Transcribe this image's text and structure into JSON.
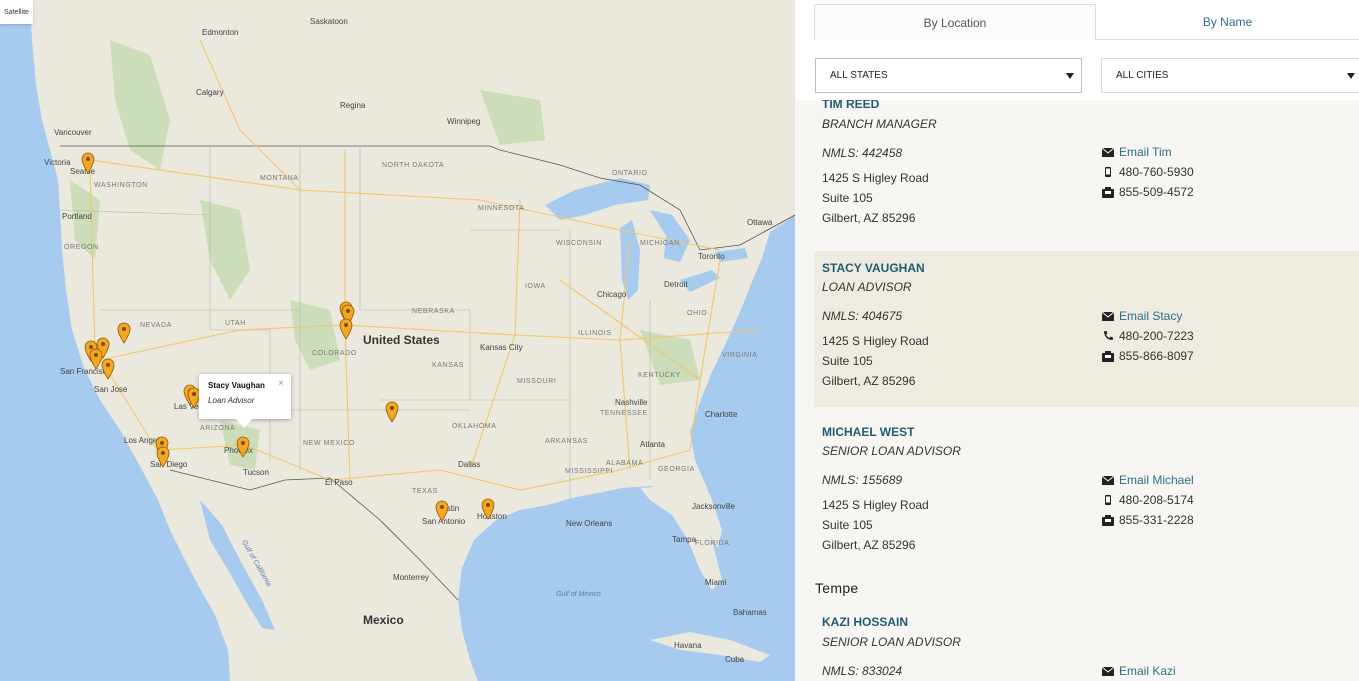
{
  "map": {
    "satellite_label": "Satellite",
    "info_window": {
      "name": "Stacy Vaughan",
      "title": "Loan Advisor",
      "close": "×"
    },
    "labels": {
      "edmonton": "Edmonton",
      "calgary": "Calgary",
      "saskatoon": "Saskatoon",
      "regina": "Regina",
      "winnipeg": "Winnipeg",
      "vancouver": "Vancouver",
      "victoria": "Victoria",
      "seattle": "Seattle",
      "portland": "Portland",
      "washington": "WASHINGTON",
      "oregon": "OREGON",
      "montana": "MONTANA",
      "north_dakota": "NORTH DAKOTA",
      "minnesota": "MINNESOTA",
      "wisconsin": "WISCONSIN",
      "michigan": "MICHIGAN",
      "ontario": "ONTARIO",
      "toronto": "Toronto",
      "ottawa": "Ottawa",
      "detroit": "Detroit",
      "chicago": "Chicago",
      "nebraska": "NEBRASKA",
      "iowa": "IOWA",
      "illinois": "ILLINOIS",
      "ohio": "OHIO",
      "united_states": "United States",
      "nevada": "NEVADA",
      "utah": "UTAH",
      "colorado": "COLORADO",
      "kansas": "KANSAS",
      "kansas_city": "Kansas City",
      "missouri": "MISSOURI",
      "kentucky": "KENTUCKY",
      "virginia": "VIRGINIA",
      "san_francisco": "San Francisco",
      "san_jose": "San Jose",
      "las_vegas": "Las Vegas",
      "los_angeles": "Los Angeles",
      "san_diego": "San Diego",
      "arizona": "ARIZONA",
      "phoenix": "Phoenix",
      "tucson": "Tucson",
      "new_mexico": "NEW MEXICO",
      "oklahoma": "OKLAHOMA",
      "arkansas": "ARKANSAS",
      "tennessee": "TENNESSEE",
      "nashville": "Nashville",
      "atlanta": "Atlanta",
      "charlotte": "Charlotte",
      "mississippi": "MISSISSIPPI",
      "alabama": "ALABAMA",
      "georgia": "GEORGIA",
      "el_paso": "El Paso",
      "dallas": "Dallas",
      "texas": "TEXAS",
      "austin": "Austin",
      "san_antonio": "San Antonio",
      "houston": "Houston",
      "new_orleans": "New Orleans",
      "jacksonville": "Jacksonville",
      "florida": "FLORIDA",
      "tampa": "Tampa",
      "miami": "Miami",
      "gulf_of_mexico": "Gulf of Mexico",
      "gulf_of_california": "Gulf of California",
      "mexico": "Mexico",
      "monterrey": "Monterrey",
      "bahamas": "Bahamas",
      "cuba": "Cuba",
      "havana": "Havana"
    }
  },
  "panel": {
    "tabs": {
      "by_location": "By Location",
      "by_name": "By Name"
    },
    "filters": {
      "states": "ALL STATES",
      "cities": "ALL CITIES"
    },
    "contacts": [
      {
        "name": "TIM REED",
        "title": "BRANCH MANAGER",
        "nmls": "NMLS: 442458",
        "address": [
          "1425 S Higley Road",
          "Suite 105",
          "Gilbert, AZ 85296"
        ],
        "email": "Email Tim",
        "phone": "480-760-5930",
        "fax": "855-509-4572",
        "phone_icon": "mobile-icon"
      },
      {
        "name": "STACY VAUGHAN",
        "title": "LOAN ADVISOR",
        "nmls": "NMLS: 404675",
        "address": [
          "1425 S Higley Road",
          "Suite 105",
          "Gilbert, AZ 85296"
        ],
        "email": "Email Stacy",
        "phone": "480-200-7223",
        "fax": "855-866-8097",
        "phone_icon": "phone-icon"
      },
      {
        "name": "MICHAEL WEST",
        "title": "SENIOR LOAN ADVISOR",
        "nmls": "NMLS: 155689",
        "address": [
          "1425 S Higley Road",
          "Suite 105",
          "Gilbert, AZ 85296"
        ],
        "email": "Email Michael",
        "phone": "480-208-5174",
        "fax": "855-331-2228",
        "phone_icon": "mobile-icon"
      }
    ],
    "city_heading": "Tempe",
    "partial_contact": {
      "name": "KAZI HOSSAIN",
      "title": "SENIOR LOAN ADVISOR",
      "nmls": "NMLS: 833024",
      "email": "Email Kazi"
    }
  },
  "colors": {
    "accent": "#2e6f86",
    "highlight_bg": "#eeece0",
    "pin": "#f5a623",
    "water": "#a6cbee"
  }
}
